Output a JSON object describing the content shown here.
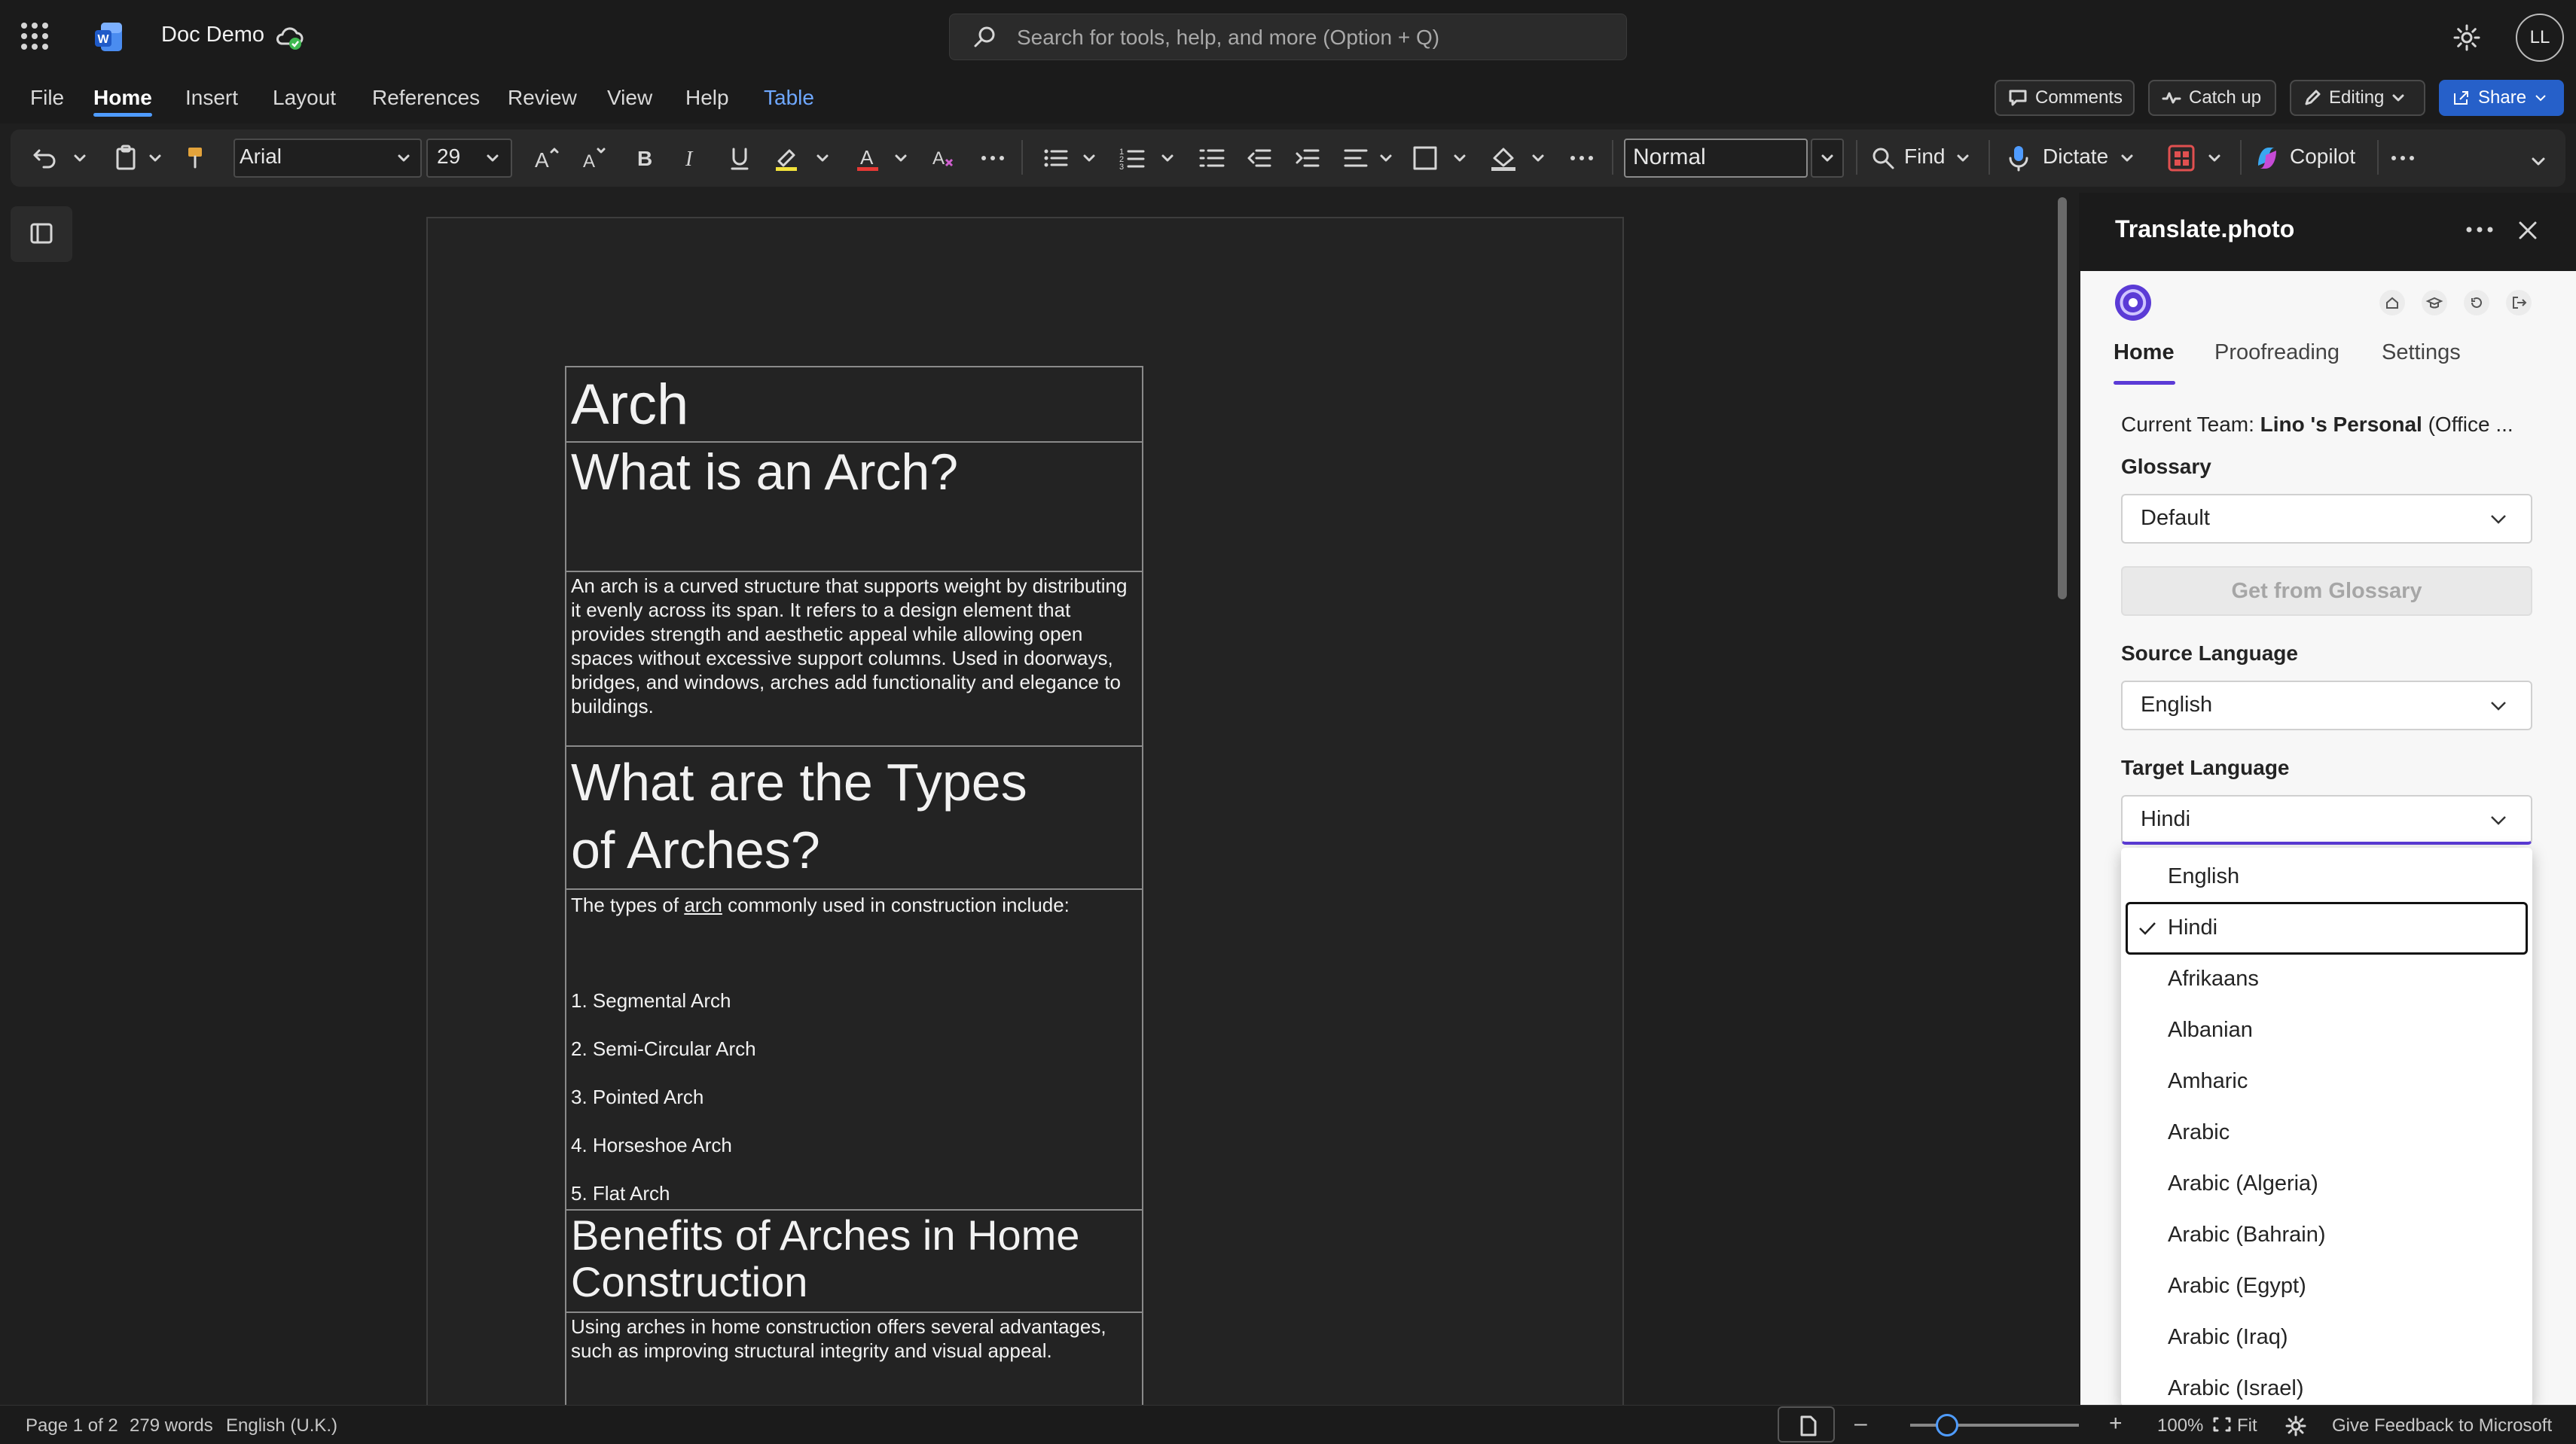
{
  "titlebar": {
    "doc_title": "Doc Demo",
    "search_placeholder": "Search for tools, help, and more (Option + Q)",
    "avatar_initials": "LL"
  },
  "menu": {
    "items": [
      "File",
      "Home",
      "Insert",
      "Layout",
      "References",
      "Review",
      "View",
      "Help",
      "Table"
    ],
    "comments": "Comments",
    "catch_up": "Catch up",
    "editing": "Editing",
    "share": "Share"
  },
  "ribbon": {
    "font_name": "Arial",
    "font_size": "29",
    "style": "Normal",
    "find": "Find",
    "dictate": "Dictate",
    "copilot": "Copilot"
  },
  "document": {
    "title": "Arch",
    "heading1": "What is an Arch?",
    "para1": "An arch is a curved structure that supports weight by distributing it evenly across its span. It refers to a design element that provides strength and aesthetic appeal while allowing open spaces without excessive support columns. Used in doorways, bridges, and windows, arches add functionality and elegance to buildings.",
    "heading2_line1": "What are the Types",
    "heading2_line2": "of Arches?",
    "types_intro_before": "The types of ",
    "types_intro_link": "arch",
    "types_intro_after": " commonly used in construction include:",
    "types": [
      "1. Segmental Arch",
      "2. Semi-Circular Arch",
      "3. Pointed Arch",
      "4. Horseshoe Arch",
      "5. Flat Arch"
    ],
    "heading3_line1": "Benefits of Arches in Home",
    "heading3_line2": "Construction",
    "para2": "Using arches in home construction offers several advantages, such as improving structural integrity and visual appeal."
  },
  "pane": {
    "title": "Translate.photo",
    "tabs": [
      "Home",
      "Proofreading",
      "Settings"
    ],
    "current_team_label": "Current Team:",
    "current_team_value": "Lino 's Personal",
    "current_team_suffix": "(Office ...",
    "glossary_label": "Glossary",
    "glossary_value": "Default",
    "glossary_button": "Get from Glossary",
    "source_label": "Source Language",
    "source_value": "English",
    "target_label": "Target Language",
    "target_value": "Hindi",
    "options": [
      "English",
      "Hindi",
      "Afrikaans",
      "Albanian",
      "Amharic",
      "Arabic",
      "Arabic (Algeria)",
      "Arabic (Bahrain)",
      "Arabic (Egypt)",
      "Arabic (Iraq)",
      "Arabic (Israel)"
    ],
    "selected_option": "Hindi",
    "accent_color": "#5b3bd6"
  },
  "status": {
    "page": "Page 1 of 2",
    "words": "279 words",
    "language": "English (U.K.)",
    "zoom": "100%",
    "fit": "Fit",
    "feedback": "Give Feedback to Microsoft"
  }
}
